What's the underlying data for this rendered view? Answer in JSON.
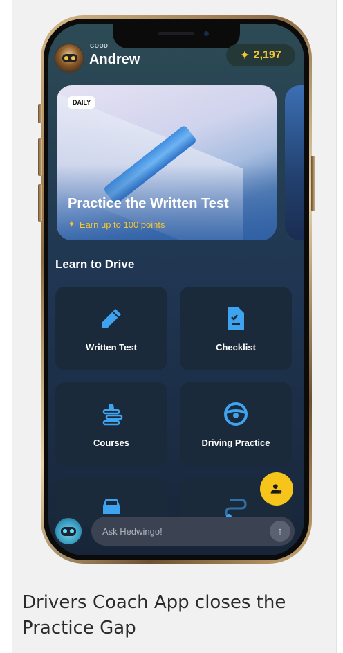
{
  "header": {
    "greeting": "GOOD",
    "username": "Andrew",
    "points": "2,197"
  },
  "hero_card": {
    "badge": "DAILY",
    "title": "Practice the Written Test",
    "subtitle": "Earn up to 100 points"
  },
  "learn_section": {
    "title": "Learn to Drive",
    "tiles": [
      {
        "label": "Written Test",
        "icon": "pencil-icon"
      },
      {
        "label": "Checklist",
        "icon": "checklist-icon"
      },
      {
        "label": "Courses",
        "icon": "courses-icon"
      },
      {
        "label": "Driving Practice",
        "icon": "steering-wheel-icon"
      },
      {
        "label": "",
        "icon": "car-icon"
      },
      {
        "label": "",
        "icon": "route-icon"
      }
    ]
  },
  "assistant": {
    "placeholder": "Ask Hedwingo!",
    "avatar_icon": "robot-icon",
    "send_icon": "arrow-up-icon"
  },
  "fab": {
    "icon": "add-user-icon"
  },
  "caption": "Drivers Coach App closes the Practice Gap",
  "colors": {
    "accent": "#f5c531",
    "tile_bg": "#1b2a3b",
    "icon_blue": "#3fa4f0"
  }
}
